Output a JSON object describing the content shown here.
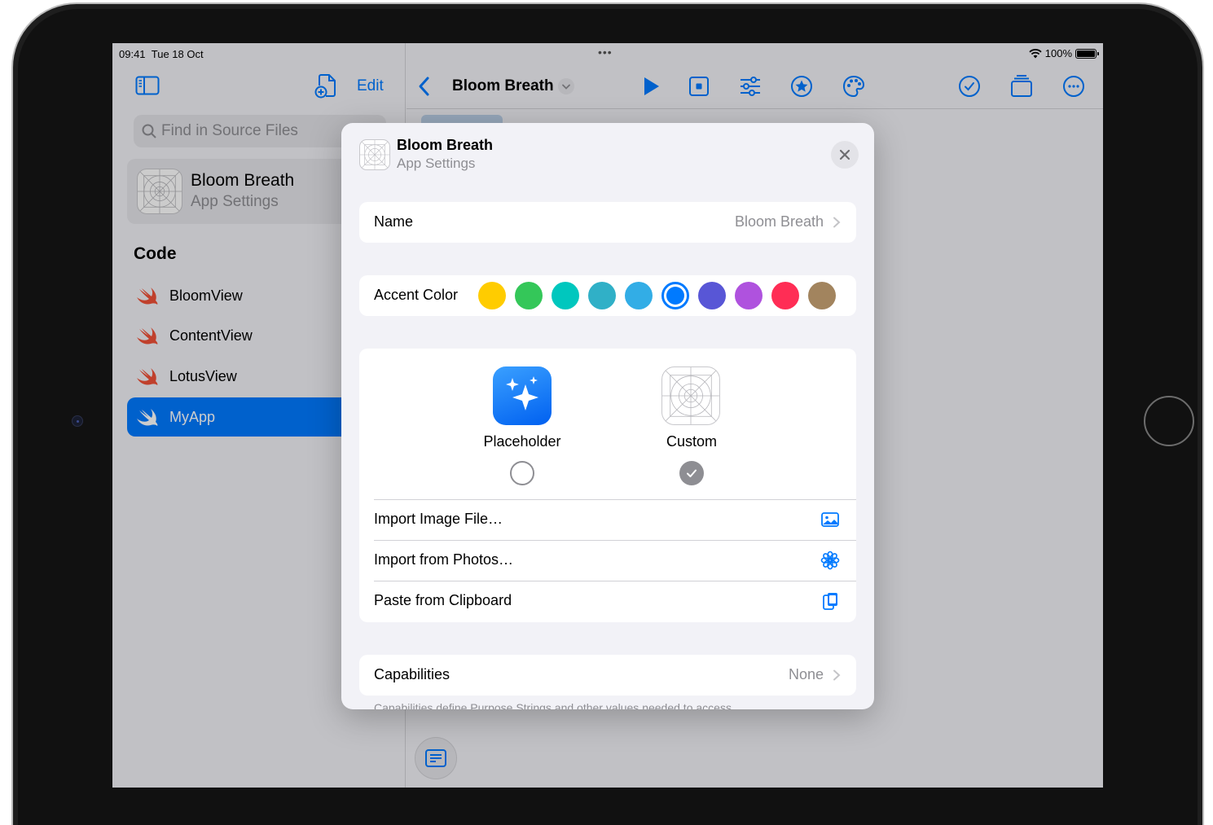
{
  "status_bar": {
    "time": "09:41",
    "date": "Tue 18 Oct",
    "battery": "100%"
  },
  "sidebar": {
    "edit_label": "Edit",
    "search_placeholder": "Find in Source Files",
    "settings_card": {
      "title": "Bloom Breath",
      "subtitle": "App Settings"
    },
    "section_title": "Code",
    "files": [
      {
        "label": "BloomView",
        "selected": false
      },
      {
        "label": "ContentView",
        "selected": false
      },
      {
        "label": "LotusView",
        "selected": false
      },
      {
        "label": "MyApp",
        "selected": true
      }
    ]
  },
  "toolbar": {
    "title": "Bloom Breath",
    "icons": [
      "play-icon",
      "stop-square-icon",
      "sliders-icon",
      "star-circle-icon",
      "palette-icon",
      "checkmark-circle-icon",
      "windows-icon",
      "more-icon"
    ]
  },
  "modal": {
    "title": "Bloom Breath",
    "subtitle": "App Settings",
    "name_row": {
      "label": "Name",
      "value": "Bloom Breath"
    },
    "accent_row": {
      "label": "Accent Color",
      "colors": [
        "#ffcc00",
        "#34c759",
        "#00c7be",
        "#30b0c7",
        "#32ade6",
        "#007aff",
        "#5856d6",
        "#af52de",
        "#ff2d55",
        "#a2845e"
      ],
      "selected_color": "#007aff"
    },
    "icon_choices": [
      {
        "label": "Placeholder",
        "selected": false
      },
      {
        "label": "Custom",
        "selected": true
      }
    ],
    "import_actions": [
      {
        "label": "Import Image File…",
        "icon": "photo-icon"
      },
      {
        "label": "Import from Photos…",
        "icon": "photos-flower-icon"
      },
      {
        "label": "Paste from Clipboard",
        "icon": "clipboard-icon"
      }
    ],
    "capabilities_row": {
      "label": "Capabilities",
      "value": "None"
    },
    "capabilities_footnote": "Capabilities define Purpose Strings and other values needed to access"
  }
}
